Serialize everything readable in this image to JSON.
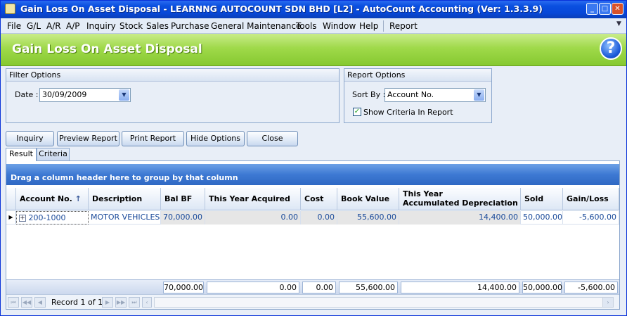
{
  "window": {
    "title": "Gain Loss On Asset Disposal - LEARNNG AUTOCOUNT SDN BHD [L2] - AutoCount Accounting (Ver: 1.3.3.9)",
    "min": "_",
    "max": "□",
    "close": "✕"
  },
  "menu": [
    "File",
    "G/L",
    "A/R",
    "A/P",
    "Inquiry",
    "Stock",
    "Sales",
    "Purchase",
    "General Maintenance",
    "Tools",
    "Window",
    "Help",
    "Report"
  ],
  "header": {
    "title": "Gain Loss On Asset Disposal",
    "help_glyph": "?"
  },
  "filter": {
    "title": "Filter Options",
    "date_label": "Date :",
    "date_value": "30/09/2009"
  },
  "report_options": {
    "title": "Report Options",
    "sort_label": "Sort By :",
    "sort_value": "Account No.",
    "show_criteria_label": "Show Criteria In Report",
    "show_criteria_checked": true
  },
  "buttons": [
    "Inquiry",
    "Preview Report",
    "Print Report",
    "Hide Options",
    "Close"
  ],
  "tabs": [
    "Result",
    "Criteria"
  ],
  "grid": {
    "group_hint": "Drag a column header here to group by that column",
    "columns": [
      "Account No.",
      "Description",
      "Bal BF",
      "This Year Acquired",
      "Cost",
      "Book Value",
      "This Year\nAccumulated Depreciation",
      "Sold",
      "Gain/Loss"
    ],
    "col_this_year_line1": "This Year",
    "col_this_year_line2": "Accumulated Depreciation",
    "sort_arrow": "↑",
    "rows": [
      {
        "expand": "+",
        "account_no": "200-1000",
        "description": "MOTOR VEHICLES",
        "bal_bf": "70,000.00",
        "this_year_acquired": "0.00",
        "cost": "0.00",
        "book_value": "55,600.00",
        "accum_dep": "14,400.00",
        "sold": "50,000.00",
        "gain_loss": "-5,600.00"
      }
    ],
    "totals": {
      "bal_bf": "70,000.00",
      "this_year_acquired": "0.00",
      "cost": "0.00",
      "book_value": "55,600.00",
      "accum_dep": "14,400.00",
      "sold": "50,000.00",
      "gain_loss": "-5,600.00"
    },
    "navigator": {
      "record_text": "Record 1 of 1"
    }
  }
}
